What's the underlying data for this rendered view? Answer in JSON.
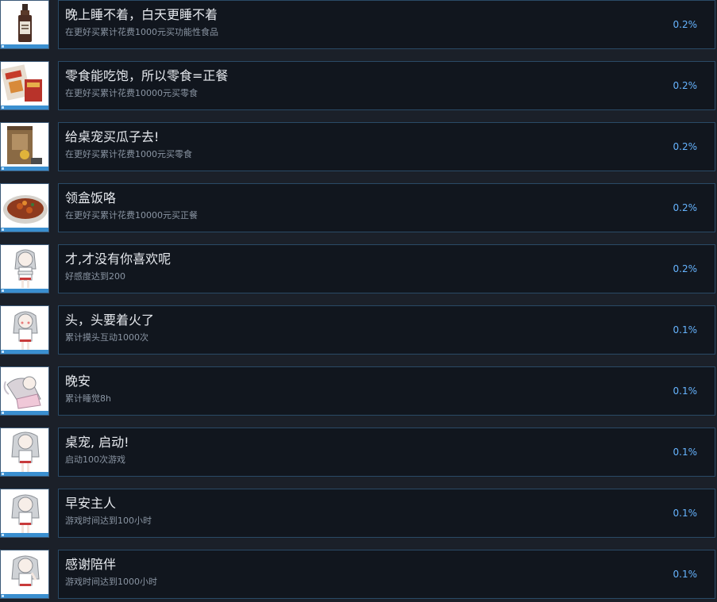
{
  "achievements": [
    {
      "title": "晚上睡不着，白天更睡不着",
      "desc": "在更好买累计花费1000元买功能性食品",
      "percent": "0.2%",
      "icon": "drink-bottle-icon"
    },
    {
      "title": "零食能吃饱，所以零食=正餐",
      "desc": "在更好买累计花费10000元买零食",
      "percent": "0.2%",
      "icon": "snack-bags-icon"
    },
    {
      "title": "给桌宠买瓜子去!",
      "desc": "在更好买累计花费1000元买零食",
      "percent": "0.2%",
      "icon": "seed-bag-icon"
    },
    {
      "title": "领盒饭咯",
      "desc": "在更好买累计花费10000元买正餐",
      "percent": "0.2%",
      "icon": "meal-plate-icon"
    },
    {
      "title": "才,才没有你喜欢呢",
      "desc": "好感度达到200",
      "percent": "0.2%",
      "icon": "pet-girl-arms-crossed-icon"
    },
    {
      "title": "头，头要着火了",
      "desc": "累计摸头互动1000次",
      "percent": "0.1%",
      "icon": "pet-girl-blushing-icon"
    },
    {
      "title": "晚安",
      "desc": "累计睡觉8h",
      "percent": "0.1%",
      "icon": "pet-girl-sleeping-icon"
    },
    {
      "title": "桌宠, 启动!",
      "desc": "启动100次游戏",
      "percent": "0.1%",
      "icon": "pet-girl-standing-icon"
    },
    {
      "title": "早安主人",
      "desc": "游戏时间达到100小时",
      "percent": "0.1%",
      "icon": "pet-girl-greeting-icon"
    },
    {
      "title": "感谢陪伴",
      "desc": "游戏时间达到1000小时",
      "percent": "0.1%",
      "icon": "pet-girl-waving-icon"
    }
  ]
}
